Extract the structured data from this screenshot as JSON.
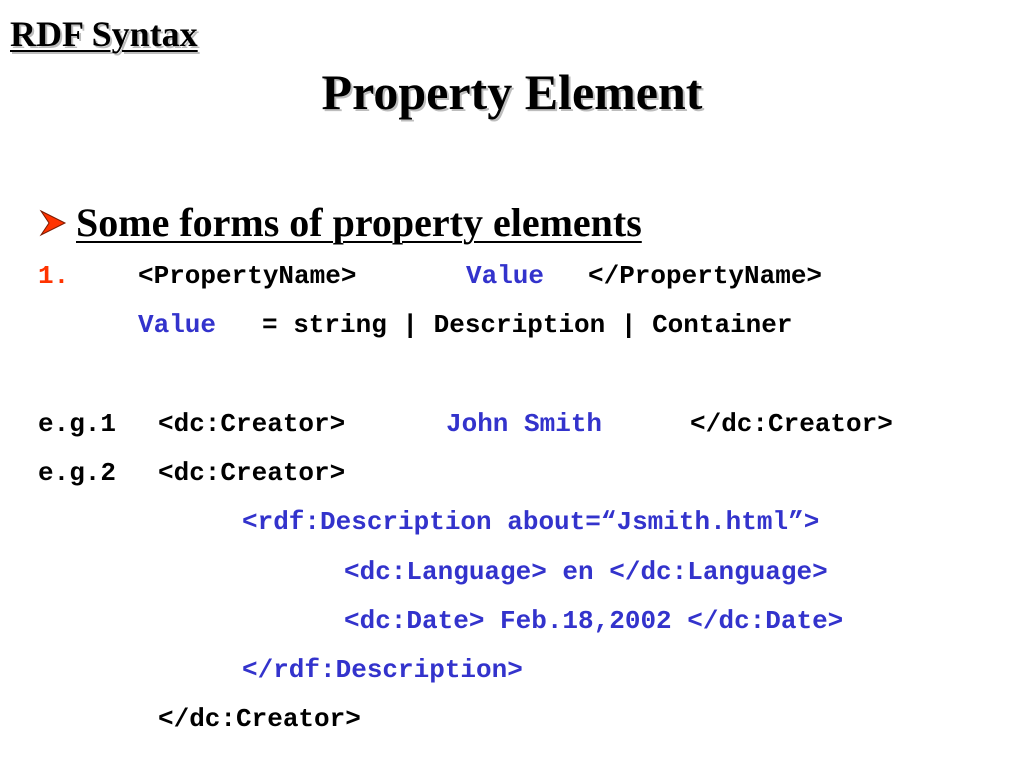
{
  "header": {
    "section_title": "RDF Syntax",
    "slide_title": "Property Element"
  },
  "bullet": {
    "icon": "arrow-bullet-icon",
    "text": "Some forms of property elements"
  },
  "colors": {
    "accent_red": "#ff3300",
    "code_blue": "#3333cc",
    "text_black": "#000000"
  },
  "item1": {
    "number": "1.",
    "open_tag": "<PropertyName>",
    "value_word": "Value",
    "close_tag": "</PropertyName>"
  },
  "value_def": {
    "label": "Value",
    "definition": "= string | Description | Container"
  },
  "example1": {
    "label": "e.g.1",
    "open_tag": "<dc:Creator>",
    "value": "John Smith",
    "close_tag": "</dc:Creator>"
  },
  "example2": {
    "label": "e.g.2",
    "open_tag": "<dc:Creator>",
    "desc_open": "<rdf:Description about=“Jsmith.html”>",
    "language_line": "<dc:Language> en </dc:Language>",
    "date_line": "<dc:Date> Feb.18,2002 </dc:Date>",
    "desc_close": "</rdf:Description>",
    "close_tag": "</dc:Creator>"
  }
}
